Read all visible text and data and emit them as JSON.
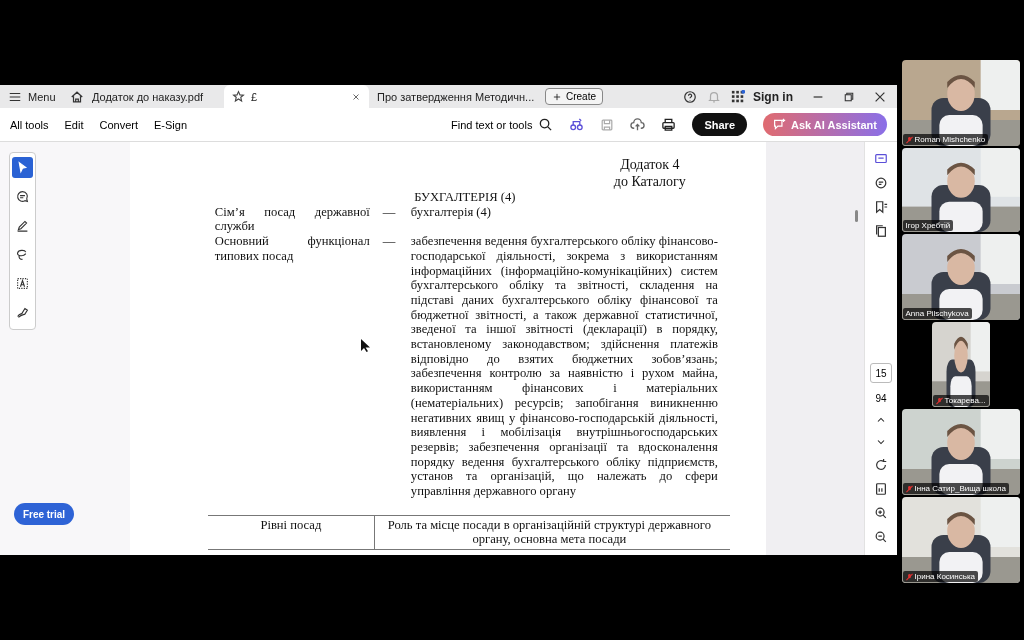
{
  "app": {
    "menu_label": "Menu",
    "tabs": [
      {
        "title": "Додаток до наказу.pdf",
        "selected": false
      },
      {
        "title": "£",
        "selected": true
      },
      {
        "title": "Про затвердження Методичн...",
        "selected": false
      }
    ],
    "create_label": "Create",
    "sign_in": "Sign in",
    "toolbar_menus": [
      "All tools",
      "Edit",
      "Convert",
      "E-Sign"
    ],
    "find_label": "Find text or tools",
    "share_label": "Share",
    "ai_label": "Ask AI Assistant",
    "free_trial": "Free trial",
    "page_number": "15",
    "page_count": "94"
  },
  "document": {
    "appendix": [
      "Додаток 4",
      "до Каталогу"
    ],
    "heading": "БУХГАЛТЕРІЯ (4)",
    "definitions": [
      {
        "term": "Сім’я посад державної служби",
        "dash": "—",
        "text": "бухгалтерія (4)"
      },
      {
        "term": "Основний функціонал типових посад",
        "dash": "—",
        "text": "забезпечення ведення бухгалтерського обліку фінансово-господарської діяльності, зокрема з використанням інформаційних (інформаційно-комунікаційних) систем бухгалтерського обліку та звітності, складення на підставі даних бухгалтерського обліку фінансової та бюджетної звітності, а також державної статистичної, зведеної та іншої звітності (декларації) в порядку, встановленому законодавством; здійснення платежів відповідно до взятих бюджетних зобов’язань; забезпечення контролю за наявністю і рухом майна, використанням фінансових і матеріальних (нематеріальних) ресурсів; запобігання виникненню негативних явищ у фінансово-господарській діяльності, виявлення і мобілізація внутрішньогосподарських резервів; забезпечення організації та вдосконалення порядку ведення бухгалтерського обліку підприємств, установ та організацій, що належать до сфери управління державного органу"
      }
    ],
    "table": {
      "columns": [
        "Рівні посад",
        "Роль та місце посади в організаційній структурі державного органу, основна мета посади"
      ]
    }
  },
  "participants": [
    {
      "name": "Roman Mishchenko",
      "muted": true,
      "color": "#b9a78f"
    },
    {
      "name": "Ігор Хребтій",
      "muted": false,
      "color": "#dfe3e6"
    },
    {
      "name": "Anna Pilschykova",
      "muted": false,
      "color": "#c9cbd0"
    },
    {
      "name": "Токарева...",
      "muted": true,
      "color": "#d6d4cf"
    },
    {
      "name": "Інна Сатир_Вища школа",
      "muted": true,
      "color": "#cdd3cf"
    },
    {
      "name": "Ірина Косинська",
      "muted": true,
      "color": "#e2e1dc"
    }
  ]
}
